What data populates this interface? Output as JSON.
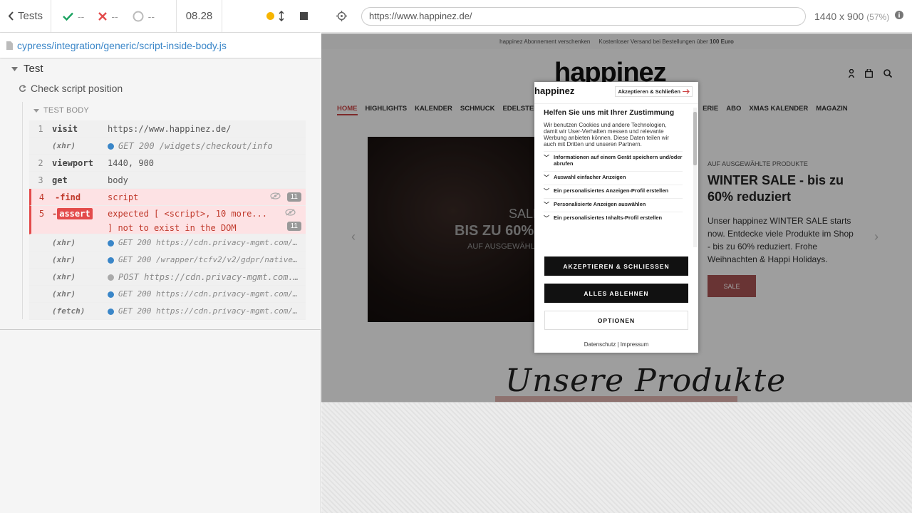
{
  "reporter": {
    "back_label": "Tests",
    "passed": "--",
    "failed": "--",
    "pending": "--",
    "duration": "08.28",
    "spec_path": "cypress/integration/generic/script-inside-body.js",
    "suite_title": "Test",
    "test_title": "Check script position",
    "body_header": "TEST BODY",
    "commands": [
      {
        "num": "1",
        "name": "visit",
        "message": "https://www.happinez.de/"
      },
      {
        "num": "",
        "name": "(xhr)",
        "message": "GET 200 /widgets/checkout/info"
      },
      {
        "num": "2",
        "name": "viewport",
        "message": "1440, 900"
      },
      {
        "num": "3",
        "name": "get",
        "message": "body"
      },
      {
        "num": "4",
        "name": "-find",
        "message": "script",
        "count": "11"
      },
      {
        "num": "5",
        "name": "assert",
        "message_line1": "expected [ <script>, 10 more...",
        "message_line2": "] not to exist in the DOM",
        "count": "11"
      },
      {
        "num": "",
        "name": "(xhr)",
        "message": "GET 200 https://cdn.privacy-mgmt.com/con..."
      },
      {
        "num": "",
        "name": "(xhr)",
        "message": "GET 200 /wrapper/tcfv2/v2/gdpr/native-me..."
      },
      {
        "num": "",
        "name": "(xhr)",
        "message": "POST https://cdn.privacy-mgmt.com..."
      },
      {
        "num": "",
        "name": "(xhr)",
        "message": "GET 200 https://cdn.privacy-mgmt.com/wra..."
      },
      {
        "num": "",
        "name": "(fetch)",
        "message": "GET 200 https://cdn.privacy-mgmt.com/con..."
      }
    ]
  },
  "aut": {
    "url": "https://www.happinez.de/",
    "viewport": "1440 x 900",
    "scale": "(57%)"
  },
  "site": {
    "promo_1": "happinez Abonnement verschenken",
    "promo_2": "Kostenloser Versand bei Bestellungen über",
    "promo_amount": "100 Euro",
    "logo": "happinez",
    "nav": [
      "HOME",
      "HIGHLIGHTS",
      "KALENDER",
      "SCHMUCK",
      "EDELSTEINE",
      "ERIE",
      "ABO",
      "XMAS KALENDER",
      "MAGAZIN"
    ],
    "hero_sale": "SALE",
    "hero_big": "BIS ZU 60%",
    "hero_small": "AUF AUSGEWÄHLT",
    "kicker": "AUF AUSGEWÄHLTE PRODUKTE",
    "title": "WINTER SALE - bis zu 60% reduziert",
    "text": "Unser happinez WINTER SALE starts now. Entdecke viele Produkte im Shop - bis zu 60% reduziert. Frohe Weihnachten & Happi Holidays.",
    "button": "SALE",
    "products_title": "Unsere Produkte"
  },
  "consent": {
    "logo": "happinez",
    "accept_top": "Akzeptieren & Schließen",
    "title": "Helfen Sie uns mit Ihrer Zustimmung",
    "text": "Wir benutzen Cookies und andere Technologien, damit wir User-Verhalten messen und relevante Werbung anbieten können. Diese Daten teilen wir auch mit Dritten und unseren Partnern.",
    "items": [
      "Informationen auf einem Gerät speichern und/oder abrufen",
      "Auswahl einfacher Anzeigen",
      "Ein personalisiertes Anzeigen-Profil erstellen",
      "Personalisierte Anzeigen auswählen",
      "Ein personalisiertes Inhalts-Profil erstellen"
    ],
    "btn_accept": "AKZEPTIEREN & SCHLIESSEN",
    "btn_reject": "ALLES ABLEHNEN",
    "btn_options": "OPTIONEN",
    "footer": "Datenschutz | Impressum"
  },
  "colors": {
    "accent_blue": "#3a86c8",
    "error_red": "#e34b4b",
    "pass_green": "#1aa260"
  }
}
